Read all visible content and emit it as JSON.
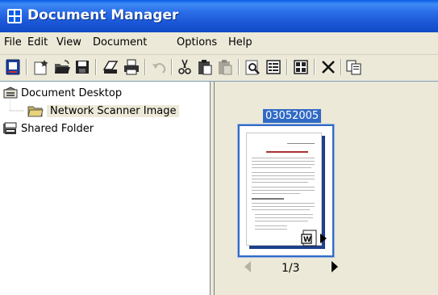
{
  "window": {
    "title": "Document Manager"
  },
  "menu": [
    "File",
    "Edit",
    "View",
    "Document",
    "Options",
    "Help"
  ],
  "toolbar": [
    "new-document-icon",
    "new-star-icon",
    "open-folder-icon",
    "save-icon",
    "scan-icon",
    "print-icon",
    "undo-icon",
    "cut-icon",
    "paste-icon",
    "paste-gray-icon",
    "zoom-icon",
    "view-list-icon",
    "view-grid-icon",
    "delete-icon",
    "copy-icon"
  ],
  "tree": {
    "items": [
      {
        "label": "Document Desktop"
      },
      {
        "label": "Network Scanner Image"
      },
      {
        "label": "Shared Folder"
      }
    ]
  },
  "thumbnail": {
    "label": "03052005",
    "page_indicator": "1/3"
  },
  "colors": {
    "title_bar": "#2c6fe9",
    "selection": "#316ac5"
  }
}
